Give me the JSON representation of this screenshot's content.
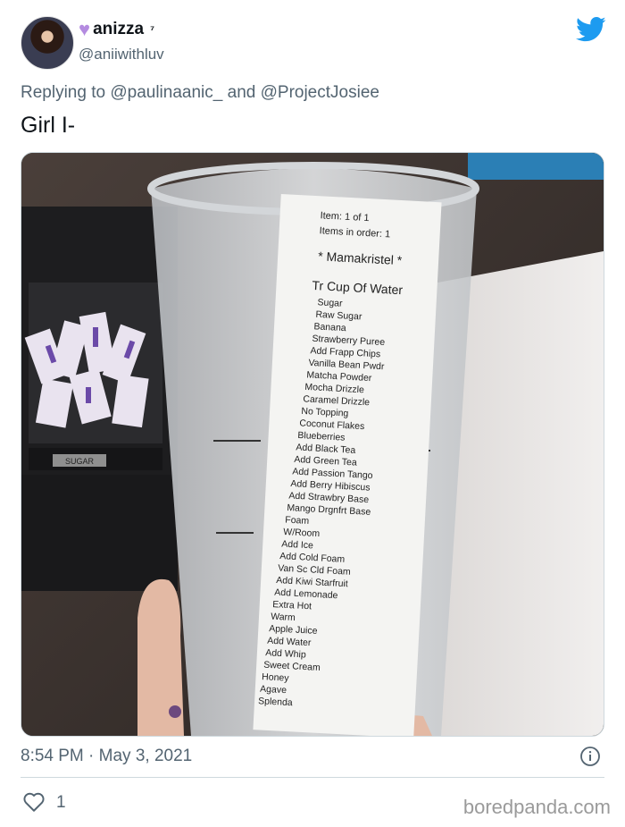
{
  "tweet": {
    "display_name": "anizza",
    "name_suffix": "⁷",
    "handle": "@aniiwithluv",
    "reply_prefix": "Replying to",
    "reply_to_1": "@paulinaanic_",
    "reply_and": "and",
    "reply_to_2": "@ProjectJosiee",
    "text": "Girl I-",
    "timestamp": "8:54 PM · May 3, 2021",
    "like_count": "1",
    "watermark": "boredpanda.com"
  },
  "receipt": {
    "item_line": "Item: 1 of 1",
    "items_in_order": "Items in order: 1",
    "customer": "* Mamakristel *",
    "drink": "Tr Cup Of Water",
    "modifiers": [
      "Sugar",
      "Raw Sugar",
      "Banana",
      "Strawberry Puree",
      "Add Frapp Chips",
      "Vanilla Bean Pwdr",
      "Matcha Powder",
      "Mocha Drizzle",
      "Caramel Drizzle",
      "No Topping",
      "Coconut Flakes",
      "Blueberries",
      "Add Black Tea",
      "Add Green Tea",
      "Add Passion Tango",
      "Add Berry Hibiscus",
      "Add Strawbry Base",
      "Mango Drgnfrt Base",
      "Foam",
      "W/Room",
      "Add Ice",
      "Add Cold Foam",
      "Van Sc Cld Foam",
      "Add Kiwi Starfruit",
      "Add Lemonade",
      "Extra Hot",
      "Warm",
      "Apple Juice",
      "Add Water",
      "Add Whip",
      "Sweet Cream",
      "Honey",
      "Agave",
      "Splenda"
    ],
    "bin_label": "SUGAR"
  },
  "colors": {
    "twitter_blue": "#1d9bf0",
    "heart_purple": "#b48be0",
    "secondary_text": "#536471"
  },
  "icons": {
    "bird": "twitter-bird-icon",
    "heart": "purple-heart-icon",
    "info": "info-icon",
    "like": "heart-outline-icon"
  }
}
